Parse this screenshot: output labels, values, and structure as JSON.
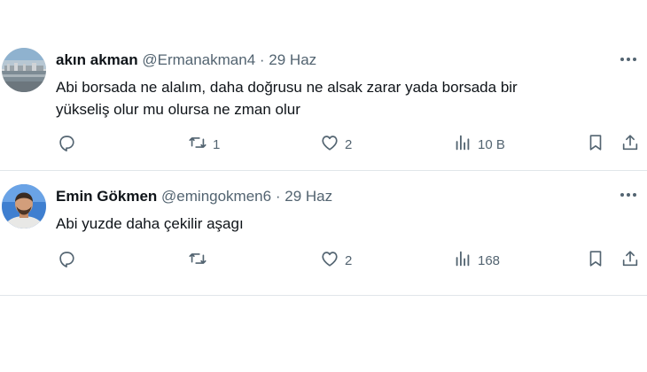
{
  "tweets": [
    {
      "name": "akın akman",
      "handle": "@Ermanakman4",
      "dot": "·",
      "date": "29 Haz",
      "text_lines": [
        "Abi borsada ne alalım, daha doğrusu ne alsak zarar yada borsada bir",
        "yükseliş olur mu olursa ne zman olur"
      ],
      "replies": "",
      "retweets": "1",
      "likes": "2",
      "views": "10 B"
    },
    {
      "name": "Emin Gökmen",
      "handle": "@emingokmen6",
      "dot": "·",
      "date": "29 Haz",
      "text_lines": [
        "Abi yuzde daha çekilir aşagı"
      ],
      "replies": "",
      "retweets": "",
      "likes": "2",
      "views": "168"
    }
  ],
  "icons": {
    "more": "more-horizontal-icon",
    "reply": "reply-icon",
    "retweet": "retweet-icon",
    "like": "heart-icon",
    "views": "views-icon",
    "bookmark": "bookmark-icon",
    "share": "share-icon"
  },
  "colors": {
    "text": "#0f1419",
    "secondary": "#536471",
    "divider": "#e1e6ea"
  }
}
